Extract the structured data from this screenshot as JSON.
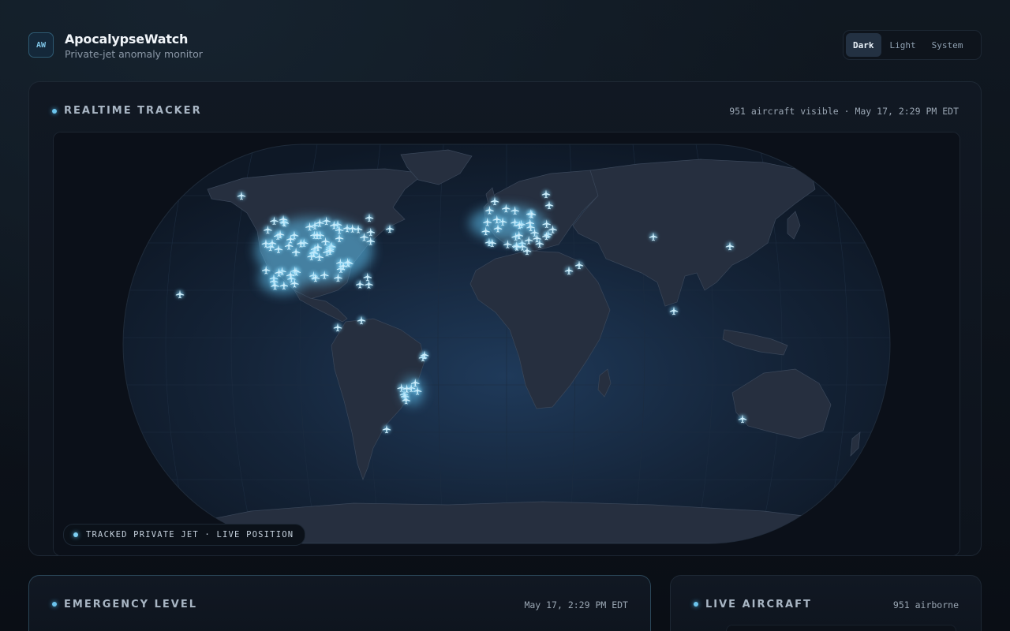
{
  "header": {
    "logo_text": "AW",
    "title": "ApocalypseWatch",
    "subtitle": "Private-jet anomaly monitor",
    "theme_options": [
      "Dark",
      "Light",
      "System"
    ],
    "theme_selected": "Dark"
  },
  "tracker": {
    "title": "REALTIME TRACKER",
    "meta": "951 aircraft visible · May 17, 2:29 PM EDT",
    "legend": "TRACKED PRIVATE JET · LIVE POSITION"
  },
  "emergency": {
    "title": "EMERGENCY LEVEL",
    "meta": "May 17, 2:29 PM EDT"
  },
  "live": {
    "title": "LIVE AIRCRAFT",
    "meta": "951 airborne"
  },
  "colors": {
    "accent": "#6cc5ee",
    "background": "#0b1018",
    "land": "#262f3f",
    "ocean": "#142234"
  },
  "icons": {
    "aircraft": "plane-icon",
    "status": "live-dot-icon"
  }
}
